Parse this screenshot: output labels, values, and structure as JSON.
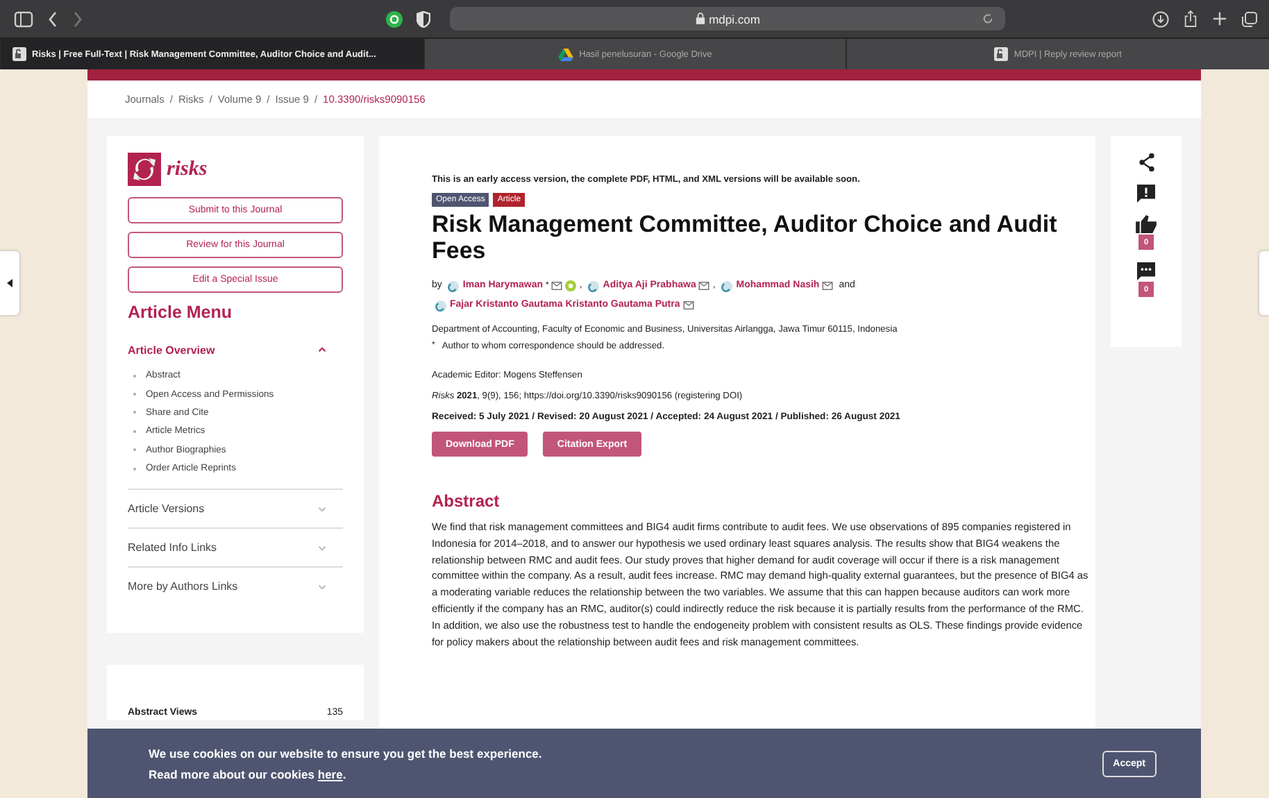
{
  "browser": {
    "address": "mdpi.com",
    "tabs": [
      {
        "title": "Risks | Free Full-Text | Risk Management Committee, Auditor Choice and Audit...",
        "selected": true
      },
      {
        "title": "Hasil penelusuran - Google Drive",
        "selected": false
      },
      {
        "title": "MDPI | Reply review report",
        "selected": false
      }
    ]
  },
  "breadcrumb": {
    "separator": "/",
    "items": [
      "Journals",
      "Risks",
      "Volume 9",
      "Issue 9",
      "10.3390/risks9090156"
    ]
  },
  "sidebar": {
    "journal": "risks",
    "buttons": [
      "Submit to this Journal",
      "Review for this Journal",
      "Edit a Special Issue"
    ],
    "menu_title": "Article Menu",
    "sections": [
      {
        "label": "Article Overview",
        "expanded": true,
        "children": [
          "Abstract",
          "Open Access and Permissions",
          "Share and Cite",
          "Article Metrics",
          "Author Biographies",
          "Order Article Reprints"
        ]
      },
      {
        "label": "Article Versions",
        "expanded": false
      },
      {
        "label": "Related Info Links",
        "expanded": false
      },
      {
        "label": "More by Authors Links",
        "expanded": false
      }
    ],
    "metrics": [
      {
        "label": "Abstract Views",
        "value": "135"
      }
    ]
  },
  "article": {
    "notice": "This is an early access version, the complete PDF, HTML, and XML versions will be available soon.",
    "badges": [
      {
        "label": "Open Access",
        "color": "#4f5570"
      },
      {
        "label": "Article",
        "color": "#b0242c"
      }
    ],
    "title": "Risk Management Committee, Auditor Choice and Audit Fees",
    "by": "by",
    "authors": [
      {
        "name": "Iman Harymawan",
        "corresponding": "*",
        "orcid": true,
        "after": ","
      },
      {
        "name": "Aditya Aji Prabhawa",
        "orcid": false,
        "after": ","
      },
      {
        "name": "Mohammad Nasih",
        "orcid": false,
        "after": "and"
      },
      {
        "name": "Fajar Kristanto Gautama Kristanto Gautama Putra",
        "orcid": false
      }
    ],
    "affiliation": "Department of Accounting, Faculty of Economic and Business, Universitas Airlangga, Jawa Timur 60115, Indonesia",
    "footnote_mark": "*",
    "footnote": "Author to whom correspondence should be addressed.",
    "editor": "Academic Editor: Mogens Steffensen",
    "citation": "*Risks* **2021**, 9(9), 156; https://doi.org/10.3390/risks9090156 (registering DOI)",
    "dates": "Received: 5 July 2021 / Revised: 20 August 2021 / Accepted: 24 August 2021 / Published: 26 August 2021",
    "buttons": [
      "Download PDF",
      "Citation Export"
    ],
    "abstract_heading": "Abstract",
    "abstract": "We find that risk management committees and BIG4 audit firms contribute to audit fees. We use observations of 895 companies registered in Indonesia for 2014–2018, and to answer our hypothesis we used ordinary least squares analysis. The results show that BIG4 weakens the relationship between RMC and audit fees. Our study proves that higher demand for audit coverage will occur if there is a risk management committee within the company. As a result, audit fees increase. RMC may demand high-quality external guarantees, but the presence of BIG4 as a moderating variable reduces the relationship between the two variables. We assume that this can happen because auditors can work more efficiently if the company has an RMC, auditor(s) could indirectly reduce the risk because it is partially results from the performance of the RMC. In addition, we also use the robustness test to handle the endogeneity problem with consistent results as OLS. These findings provide evidence for policy makers about the relationship between audit fees and risk management committees."
  },
  "tools": [
    {
      "kind": "share"
    },
    {
      "kind": "report"
    },
    {
      "kind": "like",
      "count": "0"
    },
    {
      "kind": "comment",
      "count": "0"
    }
  ],
  "cookie": {
    "line1": "We use cookies on our website to ensure you get the best experience.",
    "line2": "Read more about our cookies",
    "link": "here",
    "end": ".",
    "accept": "Accept"
  }
}
